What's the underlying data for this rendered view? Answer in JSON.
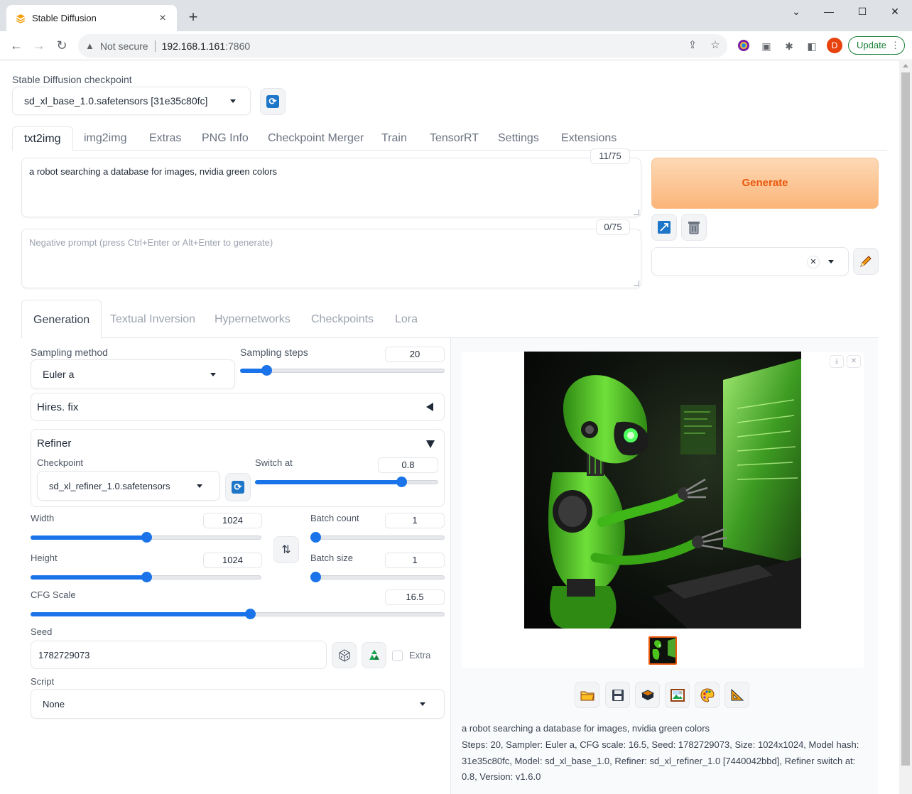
{
  "browser": {
    "tab_title": "Stable Diffusion",
    "not_secure": "Not secure",
    "url_host": "192.168.1.161",
    "url_port": ":7860",
    "avatar_letter": "D",
    "update_label": "Update"
  },
  "checkpoint": {
    "label": "Stable Diffusion checkpoint",
    "value": "sd_xl_base_1.0.safetensors [31e35c80fc]"
  },
  "main_tabs": [
    "txt2img",
    "img2img",
    "Extras",
    "PNG Info",
    "Checkpoint Merger",
    "Train",
    "TensorRT",
    "Settings",
    "Extensions"
  ],
  "prompt": {
    "value": "a robot searching a database for images, nvidia green colors",
    "counter": "11/75"
  },
  "negative_prompt": {
    "placeholder": "Negative prompt (press Ctrl+Enter or Alt+Enter to generate)",
    "counter": "0/75"
  },
  "generate_label": "Generate",
  "sub_tabs": [
    "Generation",
    "Textual Inversion",
    "Hypernetworks",
    "Checkpoints",
    "Lora"
  ],
  "generation": {
    "sampling_method_label": "Sampling method",
    "sampling_method": "Euler a",
    "sampling_steps_label": "Sampling steps",
    "sampling_steps": "20",
    "sampling_steps_fraction": 0.13,
    "hires_label": "Hires. fix",
    "refiner_label": "Refiner",
    "refiner_checkpoint_label": "Checkpoint",
    "refiner_checkpoint": "sd_xl_refiner_1.0.safetensors",
    "switch_at_label": "Switch at",
    "switch_at": "0.8",
    "switch_at_fraction": 0.8,
    "width_label": "Width",
    "width": "1024",
    "width_fraction": 0.5,
    "height_label": "Height",
    "height": "1024",
    "height_fraction": 0.5,
    "batch_count_label": "Batch count",
    "batch_count": "1",
    "batch_size_label": "Batch size",
    "batch_size": "1",
    "cfg_label": "CFG Scale",
    "cfg": "16.5",
    "cfg_fraction": 0.53,
    "seed_label": "Seed",
    "seed": "1782729073",
    "extra_label": "Extra",
    "script_label": "Script",
    "script": "None"
  },
  "output": {
    "info_prompt": "a robot searching a database for images, nvidia green colors",
    "info_params": "Steps: 20, Sampler: Euler a, CFG scale: 16.5, Seed: 1782729073, Size: 1024x1024, Model hash: 31e35c80fc, Model: sd_xl_base_1.0, Refiner: sd_xl_refiner_1.0 [7440042bbd], Refiner switch at: 0.8, Version: v1.6.0"
  },
  "colors": {
    "accent": "#1a73e8",
    "generate_text": "#ea580c",
    "robot_green": "#4cc41e"
  }
}
